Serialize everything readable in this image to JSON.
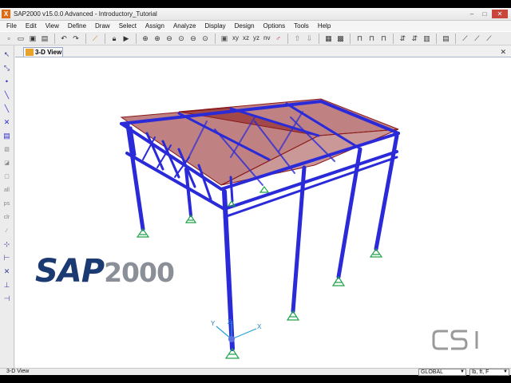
{
  "window": {
    "title": "SAP2000 v15.0.0 Advanced  - Introductory_Tutorial",
    "app_icon": "X",
    "minimize": "–",
    "maximize": "□",
    "close": "✕"
  },
  "menu": [
    "File",
    "Edit",
    "View",
    "Define",
    "Draw",
    "Select",
    "Assign",
    "Analyze",
    "Display",
    "Design",
    "Options",
    "Tools",
    "Help"
  ],
  "toolbar": {
    "view_buttons": [
      "xy",
      "xz",
      "yz",
      "nv"
    ]
  },
  "view": {
    "tab_label": "3-D View",
    "close": "✕"
  },
  "branding": {
    "logo_sap": "SAP",
    "logo_number": "2000",
    "csi_logo": "CSI"
  },
  "axes": {
    "x": "X",
    "y": "Y",
    "z": "Z"
  },
  "status": {
    "left_text": "3-D View",
    "coord_system": "GLOBAL",
    "units": "lb, ft, F"
  },
  "colors": {
    "frame": "#2a2ad8",
    "roof": "#8b1a1a",
    "support": "#1fa34a",
    "logo_blue": "#1b3a72",
    "logo_gray": "#8b8f98"
  }
}
